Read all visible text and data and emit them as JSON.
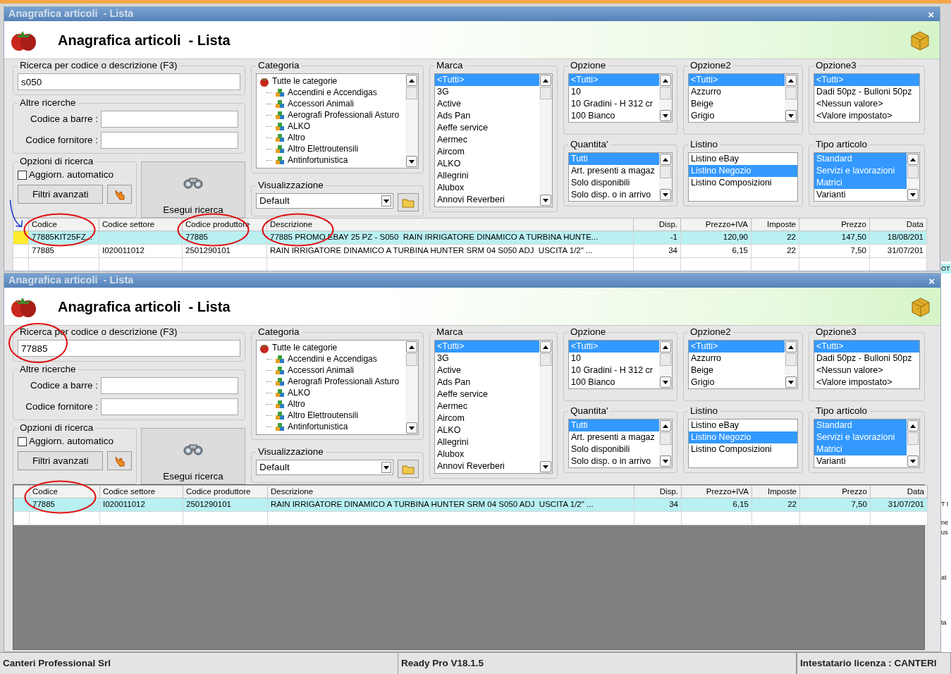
{
  "windows": [
    {
      "title": "Anagrafica articoli  - Lista",
      "close": "×",
      "heading": "Anagrafica articoli  - Lista",
      "search": {
        "label": "Ricerca per codice o descrizione (F3)",
        "value": "s050",
        "circled": false
      },
      "other_searches": {
        "label": "Altre ricerche",
        "fields": [
          {
            "label": "Codice a barre :"
          },
          {
            "label": "Codice fornitore :"
          }
        ]
      },
      "search_options": {
        "label": "Opzioni di ricerca",
        "checkbox": {
          "label": "Aggiorn. automatico",
          "checked": false
        },
        "filters_button": "Filtri avanzati"
      },
      "search_button": "Esegui ricerca",
      "category": {
        "label": "Categoria",
        "tree": {
          "label": "Tutte le categorie",
          "children": [
            {
              "label": "Accendini e Accendigas"
            },
            {
              "label": "Accessori Animali"
            },
            {
              "label": "Aerografi Professionali Asturo"
            },
            {
              "label": "ALKO"
            },
            {
              "label": "Altro"
            },
            {
              "label": "Altro Elettroutensili"
            },
            {
              "label": "Antinfortunistica"
            }
          ]
        }
      },
      "view": {
        "label": "Visualizzazione",
        "value": "Default"
      },
      "lists": [
        {
          "label": "Marca",
          "scrollbar": true,
          "items": [
            {
              "label": "<Tutti>",
              "selected": true
            },
            {
              "label": "3G",
              "selected": false
            },
            {
              "label": "Active",
              "selected": false
            },
            {
              "label": "Ads Pan",
              "selected": false
            },
            {
              "label": "Aeffe service",
              "selected": false
            },
            {
              "label": "Aermec",
              "selected": false
            },
            {
              "label": "Aircom",
              "selected": false
            },
            {
              "label": "ALKO",
              "selected": false
            },
            {
              "label": "Allegrini",
              "selected": false
            },
            {
              "label": "Alubox",
              "selected": false
            },
            {
              "label": "Annovi Reverberi",
              "selected": false
            }
          ]
        },
        {
          "label": "Opzione",
          "scrollbar": true,
          "items": [
            {
              "label": "<Tutti>",
              "selected": true
            },
            {
              "label": "10",
              "selected": false
            },
            {
              "label": "10 Gradini - H 312 cr",
              "selected": false
            },
            {
              "label": "100 Bianco",
              "selected": false
            }
          ]
        },
        {
          "label": "Quantita'",
          "scrollbar": true,
          "items": [
            {
              "label": "Tutti",
              "selected": true
            },
            {
              "label": "Art. presenti a magaz",
              "selected": false
            },
            {
              "label": "Solo disponibili",
              "selected": false
            },
            {
              "label": "Solo disp. o in arrivo",
              "selected": false
            }
          ]
        },
        {
          "label": "Opzione2",
          "scrollbar": true,
          "items": [
            {
              "label": "<Tutti>",
              "selected": true
            },
            {
              "label": "Azzurro",
              "selected": false
            },
            {
              "label": "Beige",
              "selected": false
            },
            {
              "label": "Grigio",
              "selected": false
            }
          ]
        },
        {
          "label": "Listino",
          "scrollbar": false,
          "items": [
            {
              "label": "Listino eBay",
              "selected": false
            },
            {
              "label": "Listino Negozio",
              "selected": true
            },
            {
              "label": "Listino Composizioni",
              "selected": false
            }
          ]
        },
        {
          "label": "Opzione3",
          "scrollbar": false,
          "items": [
            {
              "label": "<Tutti>",
              "selected": true
            },
            {
              "label": "Dadi 50pz - Bulloni 50pz",
              "selected": false
            },
            {
              "label": "<Nessun valore>",
              "selected": false
            },
            {
              "label": "<Valore impostato>",
              "selected": false
            }
          ]
        },
        {
          "label": "Tipo articolo",
          "scrollbar": true,
          "items": [
            {
              "label": "Standard",
              "selected": true
            },
            {
              "label": "Servizi e lavorazioni",
              "selected": true
            },
            {
              "label": "Matrici",
              "selected": true
            },
            {
              "label": "Varianti",
              "selected": false
            }
          ]
        }
      ],
      "table": {
        "arrow_mark": true,
        "columns": [
          {
            "label": "Codice",
            "kind": "text",
            "circled": true
          },
          {
            "label": "Codice settore",
            "kind": "text",
            "circled": false
          },
          {
            "label": "Codice produttore",
            "kind": "text",
            "circled": true
          },
          {
            "label": "Descrizione",
            "kind": "text",
            "circled": true
          },
          {
            "label": "Disp.",
            "kind": "number",
            "circled": false
          },
          {
            "label": "Prezzo+IVA",
            "kind": "number",
            "circled": false
          },
          {
            "label": "Imposte",
            "kind": "number",
            "circled": false
          },
          {
            "label": "Prezzo",
            "kind": "number",
            "circled": false
          },
          {
            "label": "Data",
            "kind": "number",
            "circled": false
          }
        ],
        "rows": [
          {
            "selected": true,
            "current": true,
            "cells": [
              "77885KIT25FZ...",
              "",
              "77885",
              "77885 PROMO EBAY 25 PZ - S050  RAIN IRRIGATORE DINAMICO A TURBINA HUNTE...",
              "-1",
              "120,90",
              "22",
              "147,50",
              "18/08/201"
            ]
          },
          {
            "selected": false,
            "current": false,
            "cells": [
              "77885",
              "I020011012",
              "2501290101",
              "RAIN IRRIGATORE DINAMICO A TURBINA HUNTER SRM 04 S050 ADJ  USCITA 1/2\" ...",
              "34",
              "6,15",
              "22",
              "7,50",
              "31/07/201"
            ]
          }
        ]
      }
    },
    {
      "title": "Anagrafica articoli  - Lista",
      "close": "×",
      "heading": "Anagrafica articoli  - Lista",
      "search": {
        "label": "Ricerca per codice o descrizione (F3)",
        "value": "77885",
        "circled": true
      },
      "other_searches": {
        "label": "Altre ricerche",
        "fields": [
          {
            "label": "Codice a barre :"
          },
          {
            "label": "Codice fornitore :"
          }
        ]
      },
      "search_options": {
        "label": "Opzioni di ricerca",
        "checkbox": {
          "label": "Aggiorn. automatico",
          "checked": false
        },
        "filters_button": "Filtri avanzati"
      },
      "search_button": "Esegui ricerca",
      "category": {
        "label": "Categoria",
        "tree": {
          "label": "Tutte le categorie",
          "children": [
            {
              "label": "Accendini e Accendigas"
            },
            {
              "label": "Accessori Animali"
            },
            {
              "label": "Aerografi Professionali Asturo"
            },
            {
              "label": "ALKO"
            },
            {
              "label": "Altro"
            },
            {
              "label": "Altro Elettroutensili"
            },
            {
              "label": "Antinfortunistica"
            }
          ]
        }
      },
      "view": {
        "label": "Visualizzazione",
        "value": "Default"
      },
      "lists": [
        {
          "label": "Marca",
          "scrollbar": true,
          "items": [
            {
              "label": "<Tutti>",
              "selected": true
            },
            {
              "label": "3G",
              "selected": false
            },
            {
              "label": "Active",
              "selected": false
            },
            {
              "label": "Ads Pan",
              "selected": false
            },
            {
              "label": "Aeffe service",
              "selected": false
            },
            {
              "label": "Aermec",
              "selected": false
            },
            {
              "label": "Aircom",
              "selected": false
            },
            {
              "label": "ALKO",
              "selected": false
            },
            {
              "label": "Allegrini",
              "selected": false
            },
            {
              "label": "Alubox",
              "selected": false
            },
            {
              "label": "Annovi Reverberi",
              "selected": false
            }
          ]
        },
        {
          "label": "Opzione",
          "scrollbar": true,
          "items": [
            {
              "label": "<Tutti>",
              "selected": true
            },
            {
              "label": "10",
              "selected": false
            },
            {
              "label": "10 Gradini - H 312 cr",
              "selected": false
            },
            {
              "label": "100 Bianco",
              "selected": false
            }
          ]
        },
        {
          "label": "Quantita'",
          "scrollbar": true,
          "items": [
            {
              "label": "Tutti",
              "selected": true
            },
            {
              "label": "Art. presenti a magaz",
              "selected": false
            },
            {
              "label": "Solo disponibili",
              "selected": false
            },
            {
              "label": "Solo disp. o in arrivo",
              "selected": false
            }
          ]
        },
        {
          "label": "Opzione2",
          "scrollbar": true,
          "items": [
            {
              "label": "<Tutti>",
              "selected": true
            },
            {
              "label": "Azzurro",
              "selected": false
            },
            {
              "label": "Beige",
              "selected": false
            },
            {
              "label": "Grigio",
              "selected": false
            }
          ]
        },
        {
          "label": "Listino",
          "scrollbar": false,
          "items": [
            {
              "label": "Listino eBay",
              "selected": false
            },
            {
              "label": "Listino Negozio",
              "selected": true
            },
            {
              "label": "Listino Composizioni",
              "selected": false
            }
          ]
        },
        {
          "label": "Opzione3",
          "scrollbar": false,
          "items": [
            {
              "label": "<Tutti>",
              "selected": true
            },
            {
              "label": "Dadi 50pz - Bulloni 50pz",
              "selected": false
            },
            {
              "label": "<Nessun valore>",
              "selected": false
            },
            {
              "label": "<Valore impostato>",
              "selected": false
            }
          ]
        },
        {
          "label": "Tipo articolo",
          "scrollbar": true,
          "items": [
            {
              "label": "Standard",
              "selected": true
            },
            {
              "label": "Servizi e lavorazioni",
              "selected": true
            },
            {
              "label": "Matrici",
              "selected": true
            },
            {
              "label": "Varianti",
              "selected": false
            }
          ]
        }
      ],
      "table": {
        "arrow_mark": false,
        "columns": [
          {
            "label": "Codice",
            "kind": "text",
            "circled": true
          },
          {
            "label": "Codice settore",
            "kind": "text",
            "circled": false
          },
          {
            "label": "Codice produttore",
            "kind": "text",
            "circled": false
          },
          {
            "label": "Descrizione",
            "kind": "text",
            "circled": false
          },
          {
            "label": "Disp.",
            "kind": "number",
            "circled": false
          },
          {
            "label": "Prezzo+IVA",
            "kind": "number",
            "circled": false
          },
          {
            "label": "Imposte",
            "kind": "number",
            "circled": false
          },
          {
            "label": "Prezzo",
            "kind": "number",
            "circled": false
          },
          {
            "label": "Data",
            "kind": "number",
            "circled": false
          }
        ],
        "rows": [
          {
            "selected": true,
            "current": false,
            "cells": [
              "77885",
              "I020011012",
              "2501290101",
              "RAIN IRRIGATORE DINAMICO A TURBINA HUNTER SRM 04 S050 ADJ  USCITA 1/2\" ...",
              "34",
              "6,15",
              "22",
              "7,50",
              "31/07/201"
            ]
          }
        ]
      }
    }
  ],
  "background_window": {
    "texts": [
      "OT",
      "T I",
      "ne",
      "us",
      "at",
      "ta"
    ]
  },
  "status_bar": [
    "Canteri Professional Srl",
    "Ready Pro V18.1.5",
    "Intestatario licenza : CANTERI"
  ]
}
